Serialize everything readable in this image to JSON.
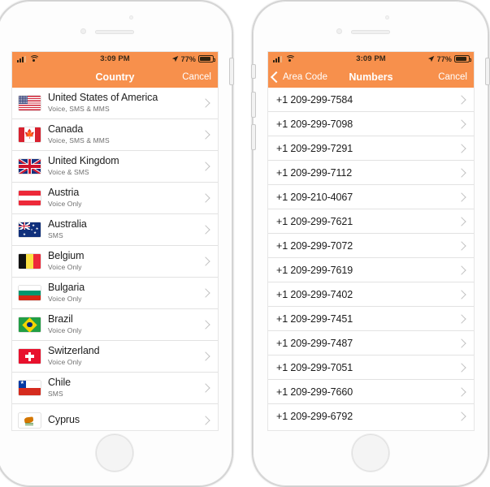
{
  "statusbar": {
    "time": "3:09 PM",
    "battery_pct": "77%",
    "signal_icon": "cellular-signal-icon",
    "wifi_icon": "wifi-icon",
    "location_icon": "location-arrow-icon",
    "battery_icon": "battery-icon"
  },
  "accent_orange": "#F7904C",
  "left_phone": {
    "navbar": {
      "title": "Country",
      "right_action": "Cancel"
    },
    "rows": [
      {
        "name": "United States of America",
        "sub": "Voice, SMS & MMS",
        "flag": "f-us"
      },
      {
        "name": "Canada",
        "sub": "Voice, SMS & MMS",
        "flag": "f-ca"
      },
      {
        "name": "United Kingdom",
        "sub": "Voice & SMS",
        "flag": "f-gb"
      },
      {
        "name": "Austria",
        "sub": "Voice Only",
        "flag": "f-at"
      },
      {
        "name": "Australia",
        "sub": "SMS",
        "flag": "f-au"
      },
      {
        "name": "Belgium",
        "sub": "Voice Only",
        "flag": "f-be"
      },
      {
        "name": "Bulgaria",
        "sub": "Voice Only",
        "flag": "f-bg"
      },
      {
        "name": "Brazil",
        "sub": "Voice Only",
        "flag": "f-br"
      },
      {
        "name": "Switzerland",
        "sub": "Voice Only",
        "flag": "f-ch"
      },
      {
        "name": "Chile",
        "sub": "SMS",
        "flag": "f-cl"
      },
      {
        "name": "Cyprus",
        "sub": "",
        "flag": "f-cy"
      }
    ]
  },
  "right_phone": {
    "navbar": {
      "back_label": "Area Code",
      "title": "Numbers",
      "right_action": "Cancel"
    },
    "rows": [
      {
        "number": "+1 209-299-7584"
      },
      {
        "number": "+1 209-299-7098"
      },
      {
        "number": "+1 209-299-7291"
      },
      {
        "number": "+1 209-299-7112"
      },
      {
        "number": "+1 209-210-4067"
      },
      {
        "number": "+1 209-299-7621"
      },
      {
        "number": "+1 209-299-7072"
      },
      {
        "number": "+1 209-299-7619"
      },
      {
        "number": "+1 209-299-7402"
      },
      {
        "number": "+1 209-299-7451"
      },
      {
        "number": "+1 209-299-7487"
      },
      {
        "number": "+1 209-299-7051"
      },
      {
        "number": "+1 209-299-7660"
      },
      {
        "number": "+1 209-299-6792"
      }
    ]
  }
}
